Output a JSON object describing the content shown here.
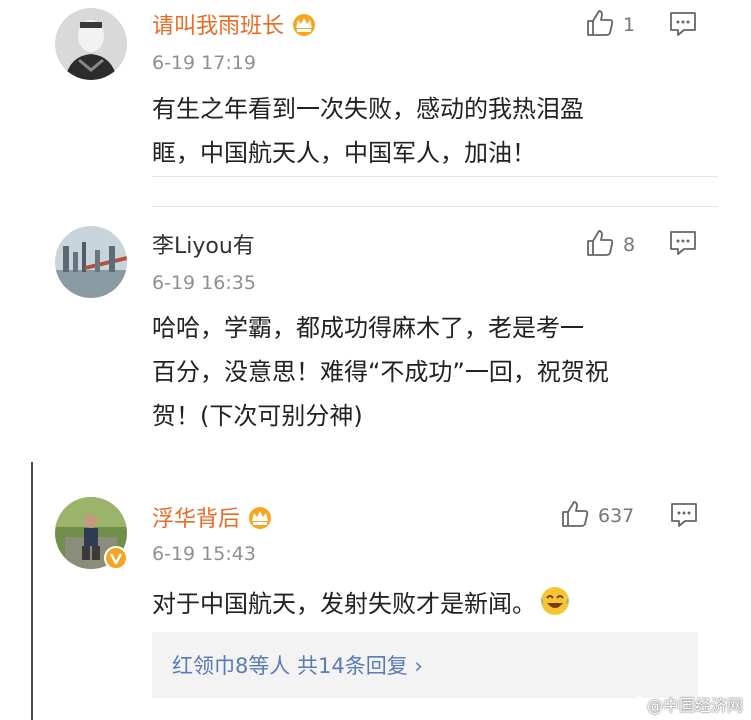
{
  "comments": [
    {
      "username": "请叫我雨班长",
      "time": "6-19 17:19",
      "text_lines": [
        "有生之年看到一次失败，感动的我热泪盈",
        "眶，中国航天人，中国军人，加油！"
      ],
      "likes": "1",
      "badge_icon": "crown-icon"
    },
    {
      "username": "李Liyou有",
      "time": "6-19 16:35",
      "text_lines": [
        "哈哈，学霸，都成功得麻木了，老是考一",
        "百分，没意思！难得“不成功”一回，祝贺祝",
        "贺！(下次可别分神)"
      ],
      "likes": "8"
    },
    {
      "username": "浮华背后",
      "time": "6-19 15:43",
      "text": "对于中国航天，发射失败才是新闻。",
      "likes": "637",
      "badge_icon": "crown-icon",
      "reply_summary": "红领巾8等人  共14条回复 ›"
    }
  ],
  "watermark": "@中国经济网",
  "colors": {
    "username_orange": "#e86b26",
    "reply_link_blue": "#5b7bb4",
    "timestamp_gray": "#8f8f8f",
    "reply_box_bg": "#f3f3f3"
  }
}
